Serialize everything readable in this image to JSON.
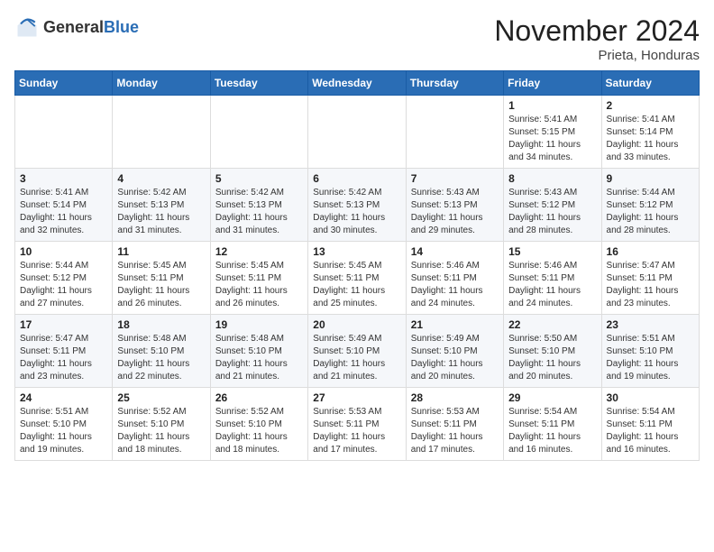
{
  "logo": {
    "general": "General",
    "blue": "Blue"
  },
  "header": {
    "month": "November 2024",
    "location": "Prieta, Honduras"
  },
  "weekdays": [
    "Sunday",
    "Monday",
    "Tuesday",
    "Wednesday",
    "Thursday",
    "Friday",
    "Saturday"
  ],
  "weeks": [
    [
      {
        "day": "",
        "info": ""
      },
      {
        "day": "",
        "info": ""
      },
      {
        "day": "",
        "info": ""
      },
      {
        "day": "",
        "info": ""
      },
      {
        "day": "",
        "info": ""
      },
      {
        "day": "1",
        "info": "Sunrise: 5:41 AM\nSunset: 5:15 PM\nDaylight: 11 hours and 34 minutes."
      },
      {
        "day": "2",
        "info": "Sunrise: 5:41 AM\nSunset: 5:14 PM\nDaylight: 11 hours and 33 minutes."
      }
    ],
    [
      {
        "day": "3",
        "info": "Sunrise: 5:41 AM\nSunset: 5:14 PM\nDaylight: 11 hours and 32 minutes."
      },
      {
        "day": "4",
        "info": "Sunrise: 5:42 AM\nSunset: 5:13 PM\nDaylight: 11 hours and 31 minutes."
      },
      {
        "day": "5",
        "info": "Sunrise: 5:42 AM\nSunset: 5:13 PM\nDaylight: 11 hours and 31 minutes."
      },
      {
        "day": "6",
        "info": "Sunrise: 5:42 AM\nSunset: 5:13 PM\nDaylight: 11 hours and 30 minutes."
      },
      {
        "day": "7",
        "info": "Sunrise: 5:43 AM\nSunset: 5:13 PM\nDaylight: 11 hours and 29 minutes."
      },
      {
        "day": "8",
        "info": "Sunrise: 5:43 AM\nSunset: 5:12 PM\nDaylight: 11 hours and 28 minutes."
      },
      {
        "day": "9",
        "info": "Sunrise: 5:44 AM\nSunset: 5:12 PM\nDaylight: 11 hours and 28 minutes."
      }
    ],
    [
      {
        "day": "10",
        "info": "Sunrise: 5:44 AM\nSunset: 5:12 PM\nDaylight: 11 hours and 27 minutes."
      },
      {
        "day": "11",
        "info": "Sunrise: 5:45 AM\nSunset: 5:11 PM\nDaylight: 11 hours and 26 minutes."
      },
      {
        "day": "12",
        "info": "Sunrise: 5:45 AM\nSunset: 5:11 PM\nDaylight: 11 hours and 26 minutes."
      },
      {
        "day": "13",
        "info": "Sunrise: 5:45 AM\nSunset: 5:11 PM\nDaylight: 11 hours and 25 minutes."
      },
      {
        "day": "14",
        "info": "Sunrise: 5:46 AM\nSunset: 5:11 PM\nDaylight: 11 hours and 24 minutes."
      },
      {
        "day": "15",
        "info": "Sunrise: 5:46 AM\nSunset: 5:11 PM\nDaylight: 11 hours and 24 minutes."
      },
      {
        "day": "16",
        "info": "Sunrise: 5:47 AM\nSunset: 5:11 PM\nDaylight: 11 hours and 23 minutes."
      }
    ],
    [
      {
        "day": "17",
        "info": "Sunrise: 5:47 AM\nSunset: 5:11 PM\nDaylight: 11 hours and 23 minutes."
      },
      {
        "day": "18",
        "info": "Sunrise: 5:48 AM\nSunset: 5:10 PM\nDaylight: 11 hours and 22 minutes."
      },
      {
        "day": "19",
        "info": "Sunrise: 5:48 AM\nSunset: 5:10 PM\nDaylight: 11 hours and 21 minutes."
      },
      {
        "day": "20",
        "info": "Sunrise: 5:49 AM\nSunset: 5:10 PM\nDaylight: 11 hours and 21 minutes."
      },
      {
        "day": "21",
        "info": "Sunrise: 5:49 AM\nSunset: 5:10 PM\nDaylight: 11 hours and 20 minutes."
      },
      {
        "day": "22",
        "info": "Sunrise: 5:50 AM\nSunset: 5:10 PM\nDaylight: 11 hours and 20 minutes."
      },
      {
        "day": "23",
        "info": "Sunrise: 5:51 AM\nSunset: 5:10 PM\nDaylight: 11 hours and 19 minutes."
      }
    ],
    [
      {
        "day": "24",
        "info": "Sunrise: 5:51 AM\nSunset: 5:10 PM\nDaylight: 11 hours and 19 minutes."
      },
      {
        "day": "25",
        "info": "Sunrise: 5:52 AM\nSunset: 5:10 PM\nDaylight: 11 hours and 18 minutes."
      },
      {
        "day": "26",
        "info": "Sunrise: 5:52 AM\nSunset: 5:10 PM\nDaylight: 11 hours and 18 minutes."
      },
      {
        "day": "27",
        "info": "Sunrise: 5:53 AM\nSunset: 5:11 PM\nDaylight: 11 hours and 17 minutes."
      },
      {
        "day": "28",
        "info": "Sunrise: 5:53 AM\nSunset: 5:11 PM\nDaylight: 11 hours and 17 minutes."
      },
      {
        "day": "29",
        "info": "Sunrise: 5:54 AM\nSunset: 5:11 PM\nDaylight: 11 hours and 16 minutes."
      },
      {
        "day": "30",
        "info": "Sunrise: 5:54 AM\nSunset: 5:11 PM\nDaylight: 11 hours and 16 minutes."
      }
    ]
  ]
}
